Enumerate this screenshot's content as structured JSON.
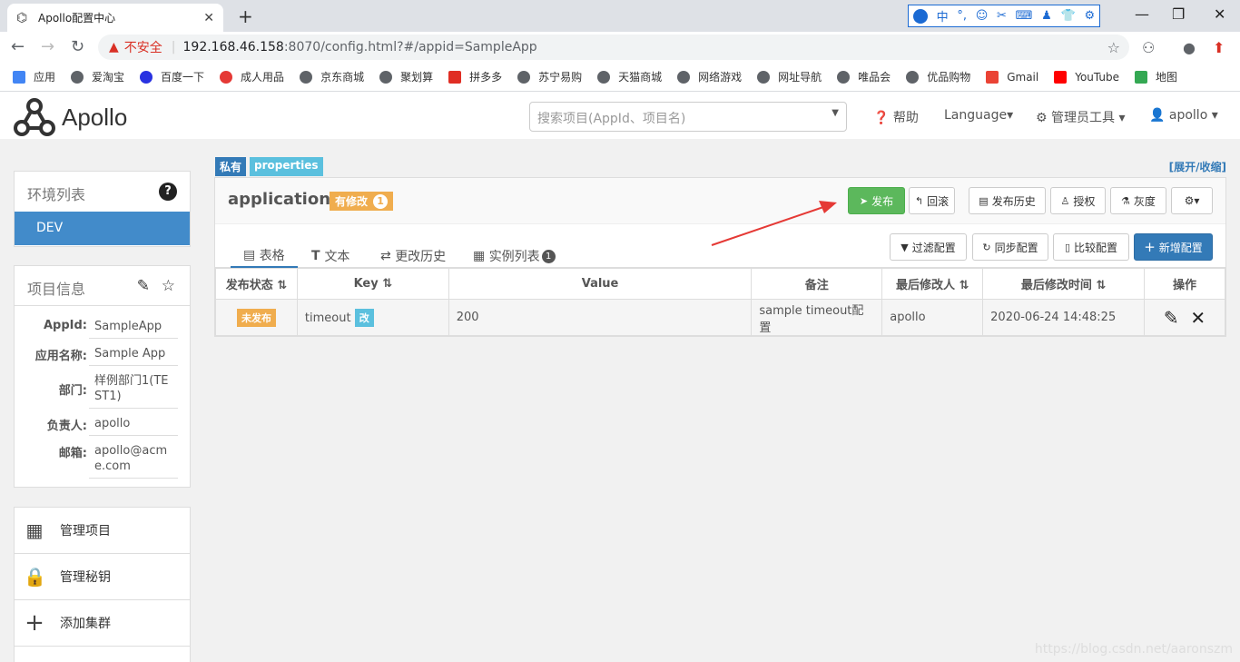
{
  "browser": {
    "tab_title": "Apollo配置中心",
    "url_warning": "不安全",
    "url_host": "192.168.46.158",
    "url_path": ":8070/config.html?#/appid=SampleApp",
    "ime_items": [
      "中",
      "°,",
      "☺",
      "✂",
      "⌨",
      "♟",
      "👕",
      "⚙"
    ],
    "bookmarks": [
      "应用",
      "爱淘宝",
      "百度一下",
      "成人用品",
      "京东商城",
      "聚划算",
      "拼多多",
      "苏宁易购",
      "天猫商城",
      "网络游戏",
      "网址导航",
      "唯品会",
      "优品购物",
      "Gmail",
      "YouTube",
      "地图"
    ]
  },
  "header": {
    "logo_text": "Apollo",
    "search_placeholder": "搜索项目(AppId、项目名)",
    "help": "帮助",
    "language": "Language",
    "admin_tools": "管理员工具",
    "user": "apollo"
  },
  "env_panel": {
    "title": "环境列表",
    "envs": [
      "DEV"
    ]
  },
  "project_info": {
    "title": "项目信息",
    "fields": [
      {
        "label": "AppId:",
        "value": "SampleApp"
      },
      {
        "label": "应用名称:",
        "value": "Sample App"
      },
      {
        "label": "部门:",
        "value": "样例部门1(TEST1)"
      },
      {
        "label": "负责人:",
        "value": "apollo"
      },
      {
        "label": "邮箱:",
        "value": "apollo@acme.com"
      }
    ]
  },
  "side_actions": [
    "管理项目",
    "管理秘钥",
    "添加集群"
  ],
  "namespace": {
    "labels": [
      "私有",
      "properties"
    ],
    "toggle": "[展开/收缩]",
    "name": "application",
    "modified_label": "有修改",
    "modified_count": "1",
    "buttons": {
      "publish": "发布",
      "rollback": "回滚",
      "history": "发布历史",
      "grant": "授权",
      "gray": "灰度",
      "filter": "过滤配置",
      "sync": "同步配置",
      "compare": "比较配置",
      "add": "新增配置"
    },
    "tabs": [
      "表格",
      "文本",
      "更改历史",
      "实例列表"
    ],
    "instance_count": "1",
    "columns": [
      "发布状态",
      "Key",
      "Value",
      "备注",
      "最后修改人",
      "最后修改时间",
      "操作"
    ],
    "rows": [
      {
        "status": "未发布",
        "key": "timeout",
        "key_tag": "改",
        "value": "200",
        "comment": "sample timeout配置",
        "modifier": "apollo",
        "time": "2020-06-24 14:48:25"
      }
    ]
  },
  "watermark": "https://blog.csdn.net/aaronszm",
  "colors": {
    "primary": "#337ab7",
    "success": "#5cb85c",
    "warning": "#f0ad4e",
    "info": "#5bc0de",
    "arrow": "#e53935"
  }
}
